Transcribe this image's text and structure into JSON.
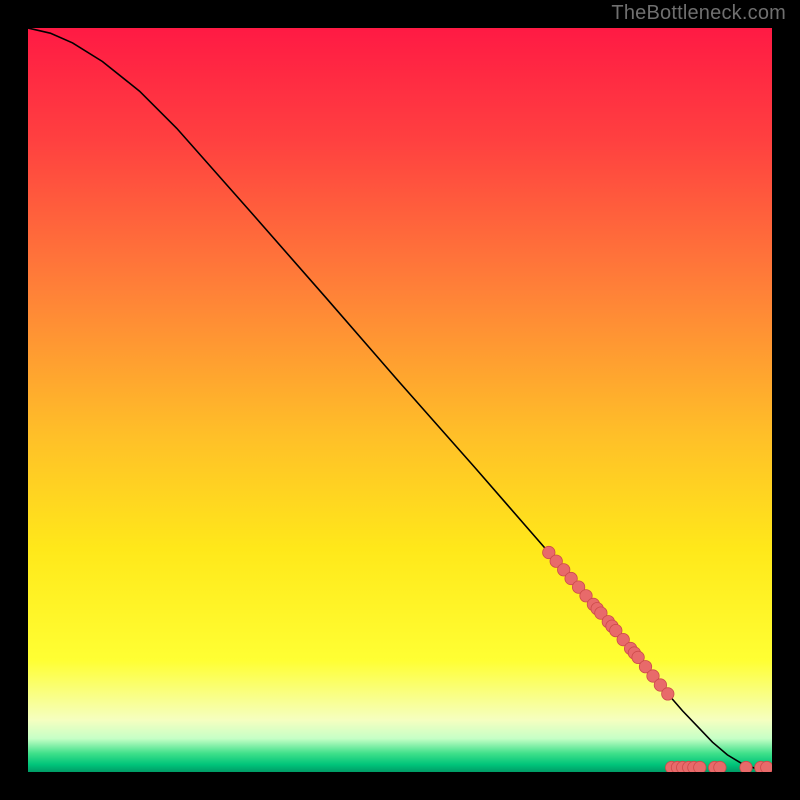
{
  "attribution": "TheBottleneck.com",
  "colors": {
    "gradient_stops": [
      {
        "offset": 0.0,
        "color": "#ff1a44"
      },
      {
        "offset": 0.15,
        "color": "#ff4040"
      },
      {
        "offset": 0.35,
        "color": "#ff8038"
      },
      {
        "offset": 0.55,
        "color": "#ffc028"
      },
      {
        "offset": 0.7,
        "color": "#ffe81a"
      },
      {
        "offset": 0.85,
        "color": "#ffff33"
      },
      {
        "offset": 0.93,
        "color": "#f5ffc0"
      },
      {
        "offset": 0.955,
        "color": "#c6ffc6"
      },
      {
        "offset": 0.975,
        "color": "#3fe08a"
      },
      {
        "offset": 0.99,
        "color": "#00c47a"
      },
      {
        "offset": 1.0,
        "color": "#009c66"
      }
    ],
    "curve": "#000000",
    "marker_fill": "#e86a6a",
    "marker_stroke": "#cc4a4a"
  },
  "chart_data": {
    "type": "line",
    "title": "",
    "xlabel": "",
    "ylabel": "",
    "xlim": [
      0,
      100
    ],
    "ylim": [
      0,
      100
    ],
    "series": [
      {
        "name": "curve",
        "x": [
          0,
          3,
          6,
          10,
          15,
          20,
          30,
          40,
          50,
          60,
          70,
          78,
          82,
          84,
          86,
          88,
          90,
          92,
          94,
          96,
          98,
          100
        ],
        "y": [
          100,
          99.3,
          98.0,
          95.5,
          91.5,
          86.5,
          75.2,
          63.8,
          52.3,
          41.0,
          29.5,
          20.2,
          15.4,
          12.9,
          10.5,
          8.2,
          6.1,
          4.0,
          2.3,
          1.1,
          0.4,
          0.1
        ]
      }
    ],
    "markers_on_curve_x": [
      70,
      71,
      72,
      73,
      74,
      75,
      76,
      76.5,
      77,
      78,
      78.5,
      79,
      80,
      81,
      81.5,
      82,
      83,
      84,
      85,
      86
    ],
    "markers_flat": [
      {
        "x": 86.5,
        "y": 0.6
      },
      {
        "x": 87.3,
        "y": 0.6
      },
      {
        "x": 88.0,
        "y": 0.6
      },
      {
        "x": 88.8,
        "y": 0.6
      },
      {
        "x": 89.5,
        "y": 0.6
      },
      {
        "x": 90.3,
        "y": 0.6
      },
      {
        "x": 92.3,
        "y": 0.6
      },
      {
        "x": 93.0,
        "y": 0.6
      },
      {
        "x": 96.5,
        "y": 0.6
      },
      {
        "x": 98.5,
        "y": 0.6
      },
      {
        "x": 99.3,
        "y": 0.6
      }
    ]
  }
}
